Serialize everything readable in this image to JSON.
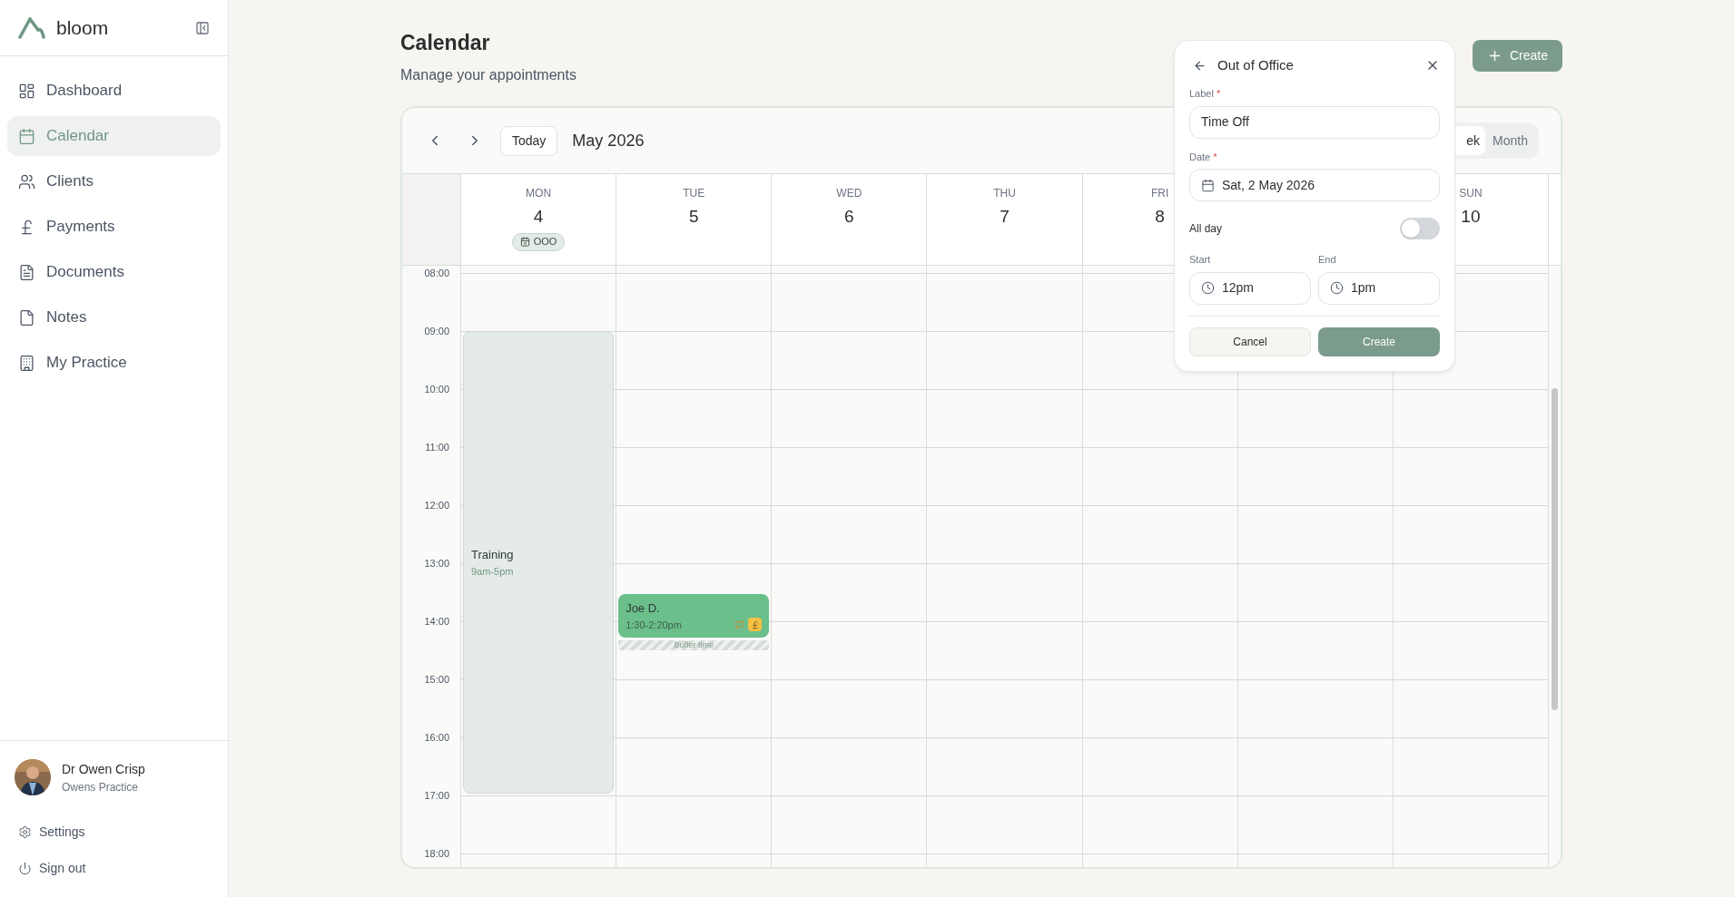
{
  "sidebar": {
    "brand": "bloom",
    "nav": [
      {
        "label": "Dashboard",
        "selected": false
      },
      {
        "label": "Calendar",
        "selected": true
      },
      {
        "label": "Clients",
        "selected": false
      },
      {
        "label": "Payments",
        "selected": false
      },
      {
        "label": "Documents",
        "selected": false
      },
      {
        "label": "Notes",
        "selected": false
      },
      {
        "label": "My Practice",
        "selected": false
      }
    ],
    "user": {
      "name": "Dr Owen Crisp",
      "practice": "Owens Practice"
    },
    "footer": [
      {
        "label": "Settings"
      },
      {
        "label": "Sign out"
      }
    ]
  },
  "header": {
    "title": "Calendar",
    "subtitle": "Manage your appointments",
    "create_button": "Create"
  },
  "calendar": {
    "today_button": "Today",
    "month": "May 2026",
    "views": [
      {
        "label": "ek",
        "selected": true
      },
      {
        "label": "Month",
        "selected": false
      }
    ],
    "hours": [
      "08:00",
      "09:00",
      "10:00",
      "11:00",
      "12:00",
      "13:00",
      "14:00",
      "15:00",
      "16:00",
      "17:00",
      "18:00"
    ],
    "days": [
      {
        "name": "MON",
        "number": "4",
        "badge": "OOO",
        "events": [
          {
            "kind": "block",
            "title": "Training",
            "time": "9am-5pm"
          }
        ]
      },
      {
        "name": "TUE",
        "number": "5",
        "events": [
          {
            "kind": "appointment",
            "title": "Joe D.",
            "time": "1:30-2:20pm",
            "recurring": true,
            "paid": true,
            "buffer": "Buffer time"
          }
        ]
      },
      {
        "name": "WED",
        "number": "6"
      },
      {
        "name": "THU",
        "number": "7"
      },
      {
        "name": "FRI",
        "number": "8"
      }
    ],
    "days_after_gap": [
      {
        "name": "SUN",
        "number": "10"
      }
    ]
  },
  "popover": {
    "title": "Out of Office",
    "fields": [
      {
        "kind": "text",
        "label": "Label",
        "mark": "*",
        "value": "Time Off"
      },
      {
        "kind": "date",
        "label": "Date",
        "mark": "*",
        "value": "Sat, 2 May 2026"
      }
    ],
    "all_day": {
      "label": "All day",
      "on": false
    },
    "times": [
      {
        "label": "Start",
        "value": "12pm"
      },
      {
        "label": "End",
        "value": "1pm"
      }
    ],
    "buttons": [
      {
        "label": "Cancel",
        "kind": "secondary"
      },
      {
        "label": "Create",
        "kind": "primary"
      }
    ]
  }
}
